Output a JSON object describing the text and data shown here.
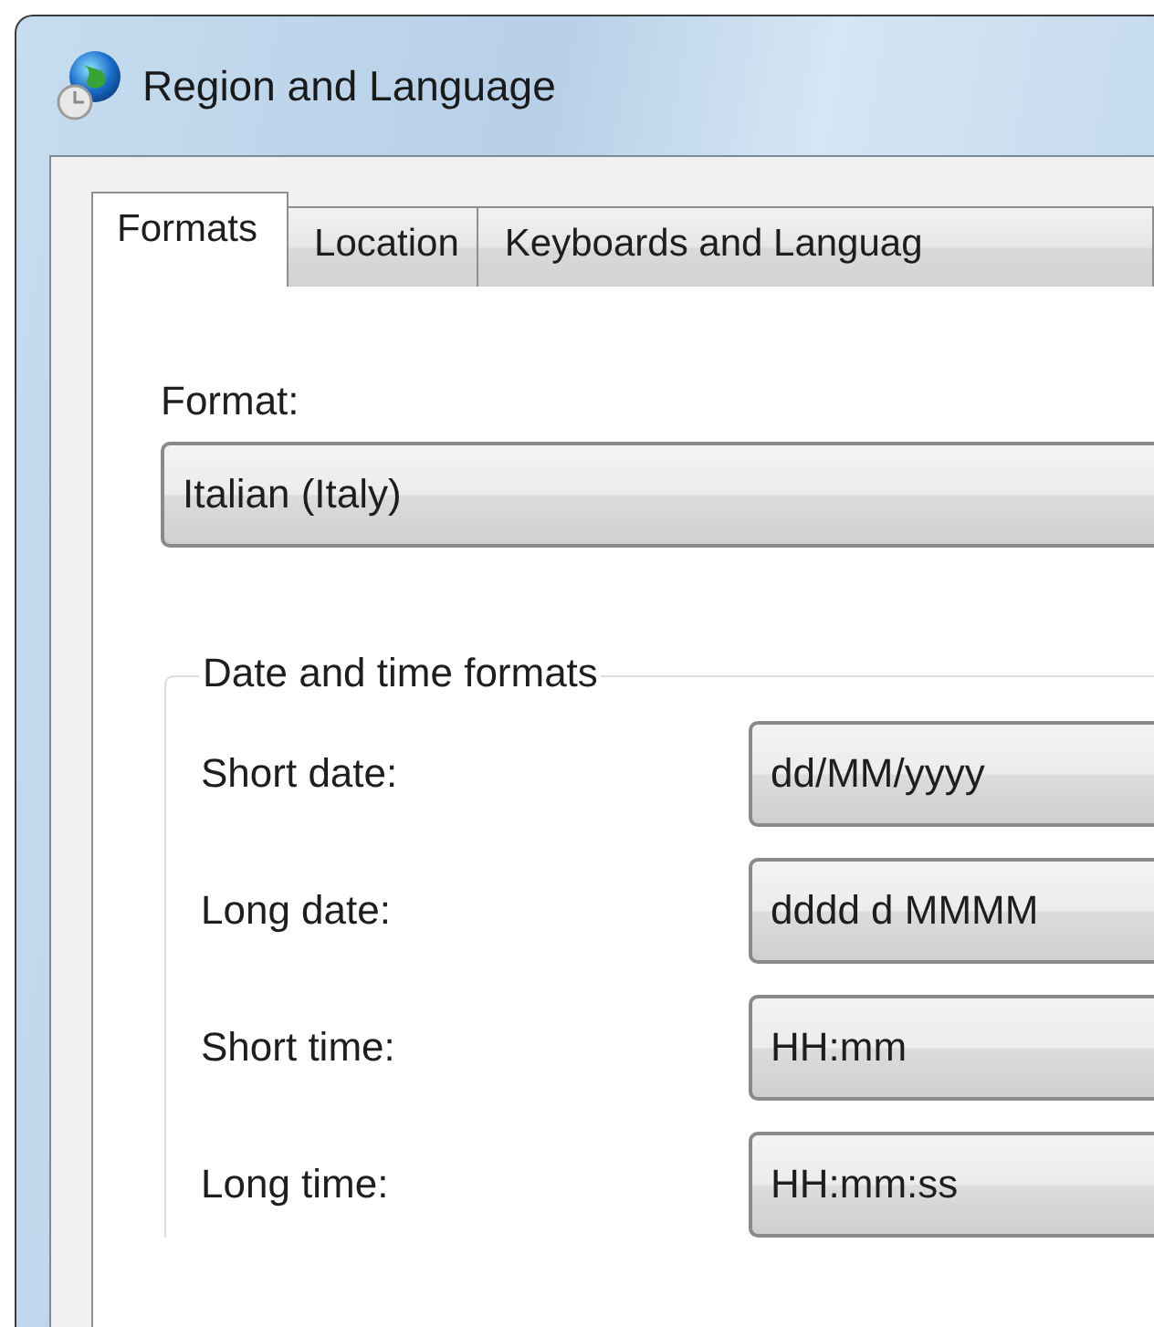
{
  "window": {
    "title": "Region and Language"
  },
  "tabs": [
    {
      "label": "Formats",
      "selected": true
    },
    {
      "label": "Location",
      "selected": false
    },
    {
      "label": "Keyboards and Languag",
      "selected": false
    }
  ],
  "format": {
    "label": "Format:",
    "value": "Italian (Italy)"
  },
  "date_time_formats": {
    "title": "Date and time formats",
    "rows": [
      {
        "label": "Short date:",
        "value": "dd/MM/yyyy"
      },
      {
        "label": "Long date:",
        "value": "dddd d MMMM"
      },
      {
        "label": "Short time:",
        "value": "HH:mm"
      },
      {
        "label": "Long time:",
        "value": "HH:mm:ss"
      }
    ]
  }
}
